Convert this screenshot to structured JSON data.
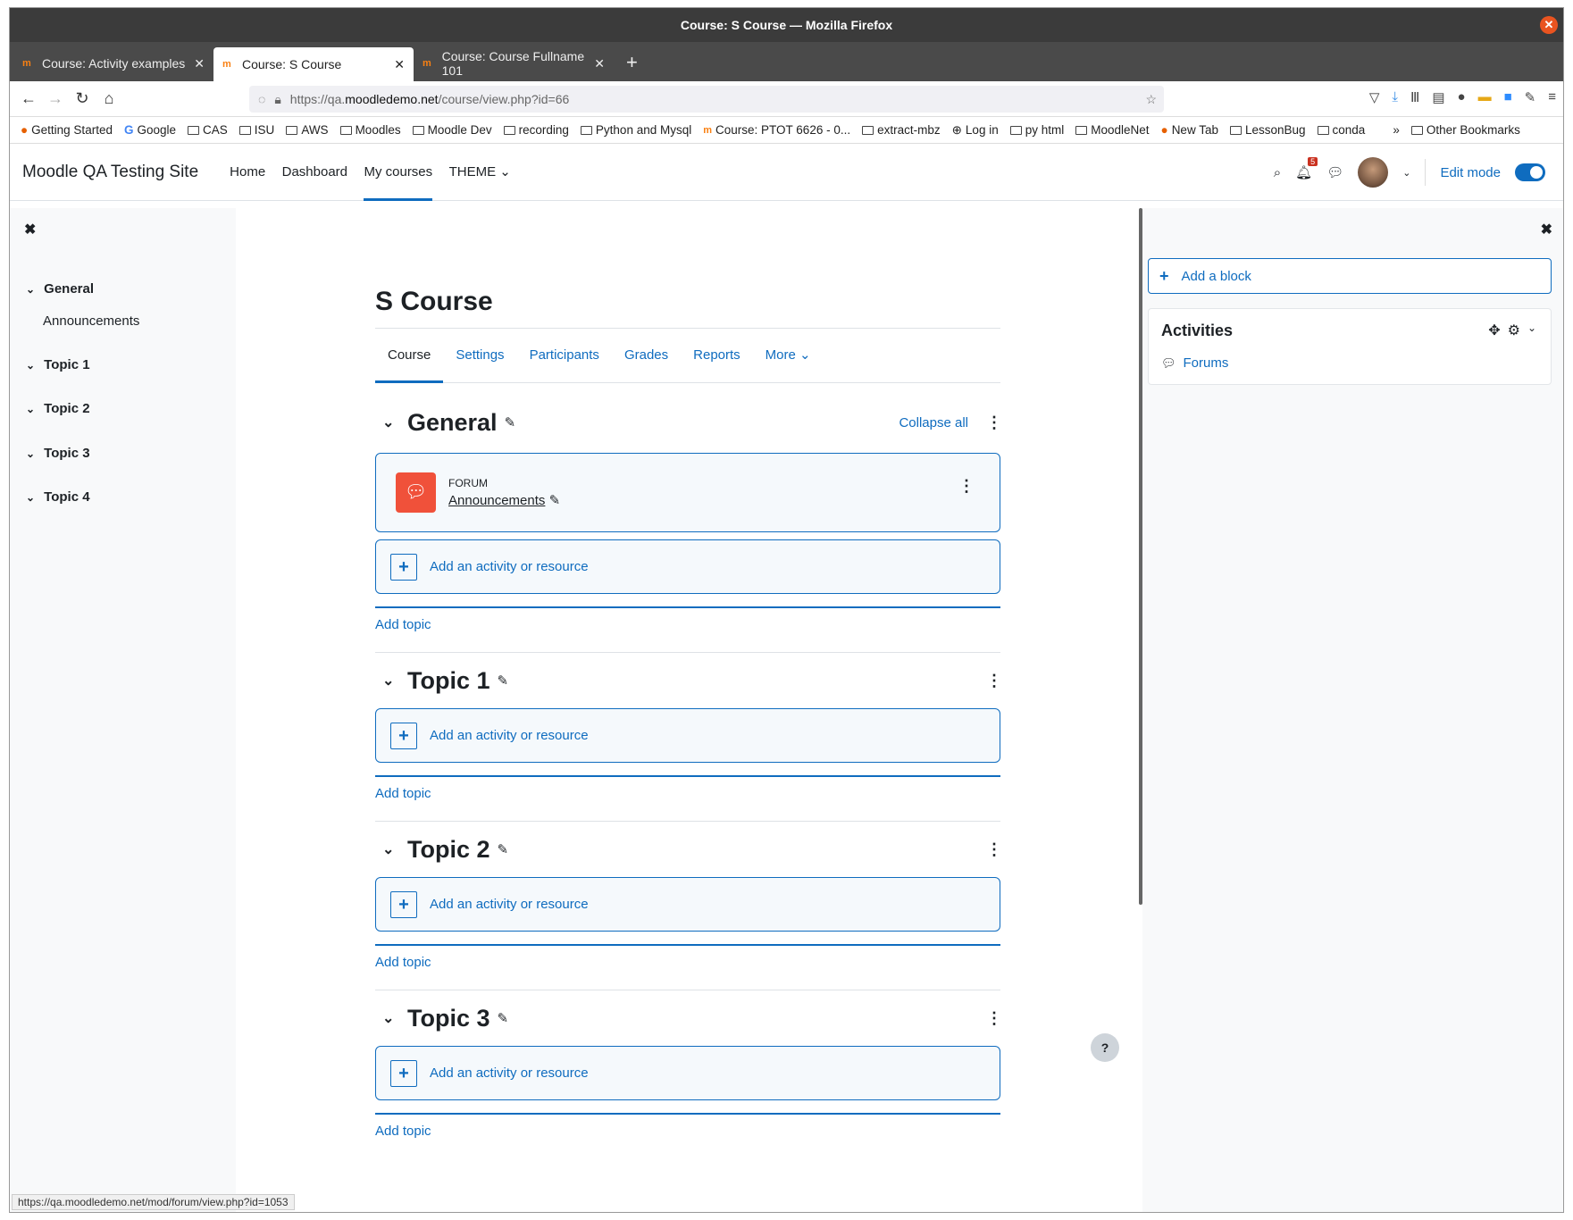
{
  "browser": {
    "window_title": "Course: S Course — Mozilla Firefox",
    "tabs": [
      {
        "label": "Course: Activity examples"
      },
      {
        "label": "Course: S Course"
      },
      {
        "label": "Course: Course Fullname 101"
      }
    ],
    "url": {
      "prefix": "https://qa.",
      "host": "moodledemo.net",
      "path": "/course/view.php?id=66"
    },
    "bookmarks": [
      {
        "label": "Getting Started"
      },
      {
        "label": "Google"
      },
      {
        "label": "CAS"
      },
      {
        "label": "ISU"
      },
      {
        "label": "AWS"
      },
      {
        "label": "Moodles"
      },
      {
        "label": "Moodle Dev"
      },
      {
        "label": "recording"
      },
      {
        "label": "Python and Mysql"
      },
      {
        "label": "Course: PTOT 6626 - 0..."
      },
      {
        "label": "extract-mbz"
      },
      {
        "label": "Log in"
      },
      {
        "label": "py html"
      },
      {
        "label": "MoodleNet"
      },
      {
        "label": "New Tab"
      },
      {
        "label": "LessonBug"
      },
      {
        "label": "conda"
      }
    ],
    "other_bookmarks": "Other Bookmarks",
    "status_url": "https://qa.moodledemo.net/mod/forum/view.php?id=1053"
  },
  "moodle": {
    "site_name": "Moodle QA Testing Site",
    "nav": [
      {
        "label": "Home"
      },
      {
        "label": "Dashboard"
      },
      {
        "label": "My courses"
      },
      {
        "label": "THEME ⌄"
      }
    ],
    "notification_count": "5",
    "edit_mode_label": "Edit mode"
  },
  "course_index": {
    "sections": [
      {
        "label": "General",
        "items": [
          "Announcements"
        ]
      },
      {
        "label": "Topic 1"
      },
      {
        "label": "Topic 2"
      },
      {
        "label": "Topic 3"
      },
      {
        "label": "Topic 4"
      }
    ]
  },
  "course": {
    "title": "S Course",
    "tabs": [
      "Course",
      "Settings",
      "Participants",
      "Grades",
      "Reports",
      "More ⌄"
    ],
    "collapse_all": "Collapse all",
    "add_activity": "Add an activity or resource",
    "add_topic": "Add topic",
    "sections": [
      {
        "title": "General",
        "activity": {
          "type": "FORUM",
          "name": "Announcements"
        }
      },
      {
        "title": "Topic 1"
      },
      {
        "title": "Topic 2"
      },
      {
        "title": "Topic 3"
      }
    ]
  },
  "blocks": {
    "add_block": "Add a block",
    "activities_title": "Activities",
    "activities_items": [
      "Forums"
    ]
  },
  "help_label": "?"
}
